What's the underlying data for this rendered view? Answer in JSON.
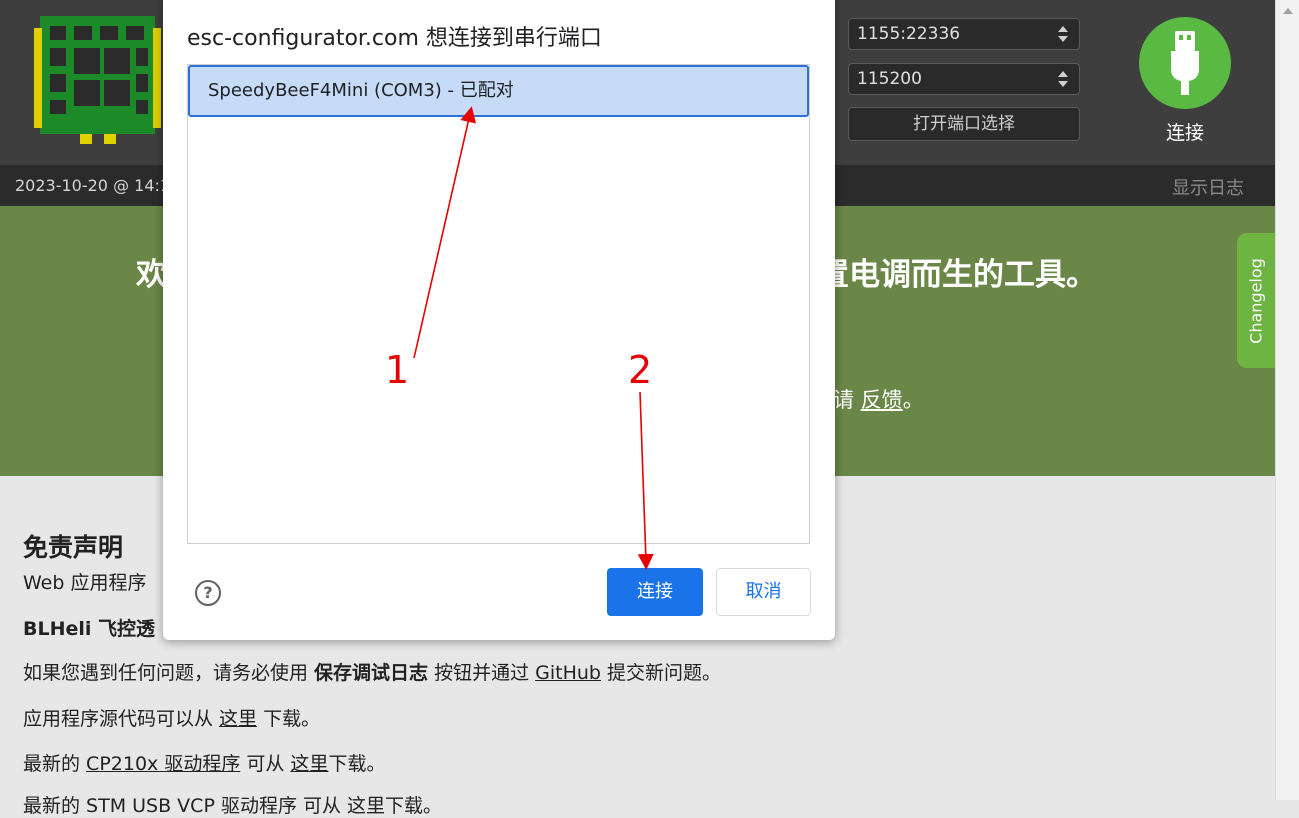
{
  "header": {
    "port_address": "1155:22336",
    "baud_rate": "115200",
    "open_port_select_label": "打开端口选择",
    "connect_label": "连接",
    "brand_green": "#59b943"
  },
  "logbar": {
    "timestamp": "2023-10-20 @ 14:1",
    "show_log_label": "显示日志"
  },
  "welcome": {
    "title_left": "欢",
    "title_right": "置电调而生的工具。",
    "feedback_prefix": "请 ",
    "feedback_link": "反馈",
    "feedback_suffix": "。",
    "changelog_label": "Changelog"
  },
  "content": {
    "disclaimer_title": "免责声明",
    "line1": "Web 应用程序",
    "line2_bold": "BLHeli 飞控透",
    "line3": {
      "p1": "如果您遇到任何问题，请务必使用 ",
      "bold": "保存调试日志",
      "p2": " 按钮并通过 ",
      "link": "GitHub",
      "p3": " 提交新问题。"
    },
    "line4": {
      "p1": "应用程序源代码可以从 ",
      "link": "这里",
      "p2": " 下载。"
    },
    "line5": {
      "p1": "最新的 ",
      "link1": "CP210x 驱动程序",
      "p2": " 可从 ",
      "link2": "这里",
      "p3": "下载。"
    },
    "line6": "最新的 STM USB VCP 驱动程序 可从 这里下载。"
  },
  "dialog": {
    "title": "esc-configurator.com 想连接到串行端口",
    "device": "SpeedyBeeF4Mini (COM3) - 已配对",
    "help_glyph": "?",
    "connect_label": "连接",
    "cancel_label": "取消",
    "accent": "#1a73e8"
  },
  "annotations": {
    "step1": "1",
    "step2": "2",
    "color": "#e60000"
  }
}
